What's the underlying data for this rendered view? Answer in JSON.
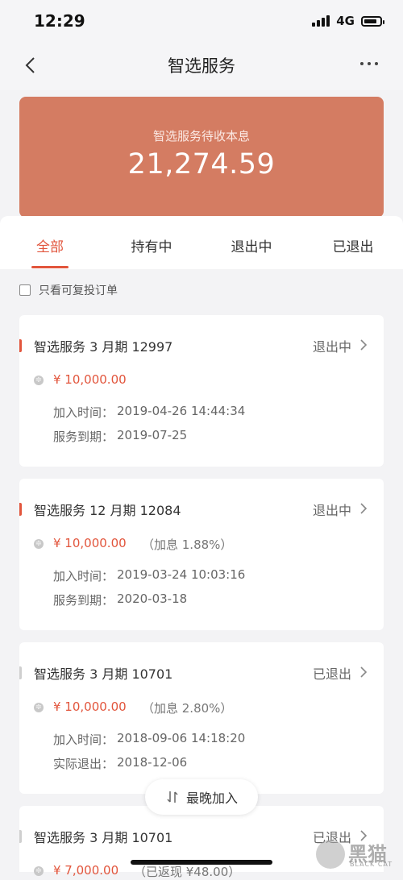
{
  "status_bar": {
    "time": "12:29",
    "network": "4G"
  },
  "nav": {
    "title": "智选服务"
  },
  "summary": {
    "label": "智选服务待收本息",
    "value": "21,274.59"
  },
  "tabs": [
    {
      "label": "全部"
    },
    {
      "label": "持有中"
    },
    {
      "label": "退出中"
    },
    {
      "label": "已退出"
    }
  ],
  "active_tab": "全部",
  "filter": {
    "label": "只看可复投订单",
    "checked": false
  },
  "orders": [
    {
      "title": "智选服务 3 月期 12997",
      "status": "退出中",
      "amount": "¥ 10,000.00",
      "extra": "",
      "row1_label": "加入时间：",
      "row1_value": "2019-04-26 14:44:34",
      "row2_label": "服务到期：",
      "row2_value": "2019-07-25"
    },
    {
      "title": "智选服务 12 月期 12084",
      "status": "退出中",
      "amount": "¥ 10,000.00",
      "extra": "（加息 1.88%）",
      "row1_label": "加入时间：",
      "row1_value": "2019-03-24 10:03:16",
      "row2_label": "服务到期：",
      "row2_value": "2020-03-18"
    },
    {
      "title": "智选服务 3 月期 10701",
      "status": "已退出",
      "amount": "¥ 10,000.00",
      "extra": "（加息 2.80%）",
      "row1_label": "加入时间：",
      "row1_value": "2018-09-06 14:18:20",
      "row2_label": "实际退出：",
      "row2_value": "2018-12-06"
    },
    {
      "title": "智选服务 3 月期 10701",
      "status": "已退出",
      "amount": "¥ 7,000.00",
      "extra": "（已返现 ¥48.00）"
    }
  ],
  "sort_button": {
    "label": "最晚加入"
  },
  "watermark": {
    "text": "黑猫",
    "sub": "BLACK CAT"
  },
  "colors": {
    "accent": "#e2553c",
    "card": "#d47c62"
  },
  "icons": [
    "back-arrow-icon",
    "more-icon",
    "chevron-right-icon",
    "coin-icon",
    "sort-icon",
    "checkbox-icon"
  ]
}
